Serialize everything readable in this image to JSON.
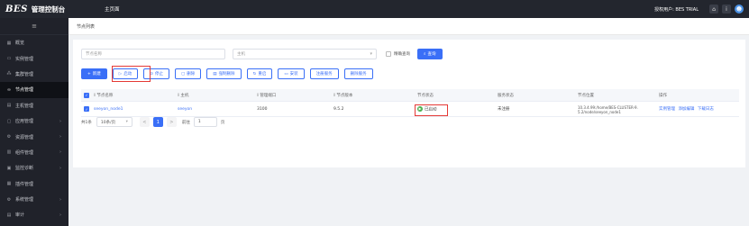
{
  "header": {
    "logo": "BES",
    "title": "管理控制台",
    "home": "主页面",
    "user_label": "授权用户: BES TRIAL",
    "icons": [
      "home-icon",
      "info-icon",
      "user-avatar-icon"
    ]
  },
  "sidebar": {
    "collapse_icon": "≡",
    "items": [
      {
        "label": "概览",
        "icon": "▦",
        "caret": ""
      },
      {
        "label": "实例管理",
        "icon": "▭",
        "caret": ""
      },
      {
        "label": "集群管理",
        "icon": "⁂",
        "caret": ""
      },
      {
        "label": "节点管理",
        "icon": "∞",
        "caret": "",
        "active": true
      },
      {
        "label": "主机管理",
        "icon": "▤",
        "caret": ""
      },
      {
        "label": "应用管理",
        "icon": "▢",
        "caret": "›"
      },
      {
        "label": "资源管理",
        "icon": "⚙",
        "caret": "›"
      },
      {
        "label": "组件管理",
        "icon": "▥",
        "caret": "›"
      },
      {
        "label": "监控诊断",
        "icon": "▣",
        "caret": "›"
      },
      {
        "label": "插件管理",
        "icon": "▦",
        "caret": ""
      },
      {
        "label": "系统管理",
        "icon": "⚙",
        "caret": "›"
      },
      {
        "label": "审计",
        "icon": "▤",
        "caret": "›"
      }
    ]
  },
  "breadcrumb": "节点列表",
  "search": {
    "node_name_placeholder": "节点名称",
    "host_placeholder": "主机",
    "exact_query_label": "精确查询",
    "query_button": "查询"
  },
  "toolbar": {
    "buttons": [
      {
        "label": "新建",
        "icon": "+",
        "solid": true
      },
      {
        "label": "启动",
        "icon": "▷"
      },
      {
        "label": "停止",
        "icon": "⊙"
      },
      {
        "label": "删除",
        "icon": "▢"
      },
      {
        "label": "强制删除",
        "icon": "▤"
      },
      {
        "label": "重启",
        "icon": "↻"
      },
      {
        "label": "安装",
        "icon": "▭"
      },
      {
        "label": "注册服务",
        "icon": ""
      },
      {
        "label": "删除服务",
        "icon": ""
      }
    ]
  },
  "table": {
    "columns": [
      "节点名称",
      "主机",
      "管理端口",
      "节点版本",
      "节点状态",
      "服务状态",
      "节点位置",
      "操作"
    ],
    "rows": [
      {
        "name": "seeyon_node1",
        "host": "seeyon",
        "port": "3100",
        "version": "9.5.2",
        "status": "已启动",
        "service_status": "未注册",
        "location_line1": "10.3.4.99:/home/BES-CLUSTER-9.",
        "location_line2": "5.2/node/seeyon_node1",
        "actions": [
          "实例管理",
          "添加编辑",
          "下载日志"
        ]
      }
    ]
  },
  "pager": {
    "total": "共1条",
    "page_size": "10条/页",
    "prev": "<",
    "current": "1",
    "next": ">",
    "goto_label": "前往",
    "goto_value": "1",
    "page_unit": "页"
  },
  "colors": {
    "primary": "#3a6ff7",
    "sidebar_bg": "#20222a",
    "header_bg": "#23262e",
    "success": "#4caf50",
    "highlight": "#e53935"
  }
}
